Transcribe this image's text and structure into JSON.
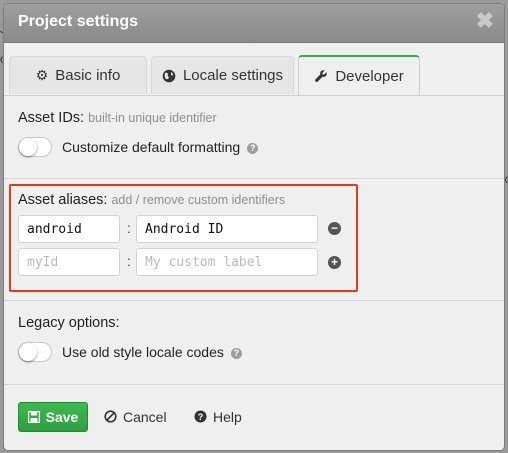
{
  "dialog": {
    "title": "Project settings",
    "close_glyph": "✖"
  },
  "tabs": [
    {
      "label": "Basic info",
      "icon": "gear-icon",
      "active": false
    },
    {
      "label": "Locale settings",
      "icon": "globe-icon",
      "active": false
    },
    {
      "label": "Developer",
      "icon": "wrench-icon",
      "active": true
    }
  ],
  "asset_ids": {
    "label": "Asset IDs:",
    "hint": "built-in unique identifier",
    "toggle_label": "Customize default formatting",
    "toggle_on": false
  },
  "asset_aliases": {
    "label": "Asset aliases:",
    "hint": "add / remove custom identifiers",
    "rows": [
      {
        "id_value": "android",
        "id_placeholder": "",
        "label_value": "Android ID",
        "label_placeholder": "",
        "action": "remove"
      },
      {
        "id_value": "",
        "id_placeholder": "myId",
        "label_value": "",
        "label_placeholder": "My custom label",
        "action": "add"
      }
    ],
    "separator": ":"
  },
  "legacy": {
    "label": "Legacy options:",
    "toggle_label": "Use old style locale codes",
    "toggle_on": false
  },
  "footer": {
    "save_label": "Save",
    "cancel_label": "Cancel",
    "help_label": "Help"
  },
  "colors": {
    "accent_green": "#35b04a",
    "highlight_red": "#e23b1c"
  }
}
